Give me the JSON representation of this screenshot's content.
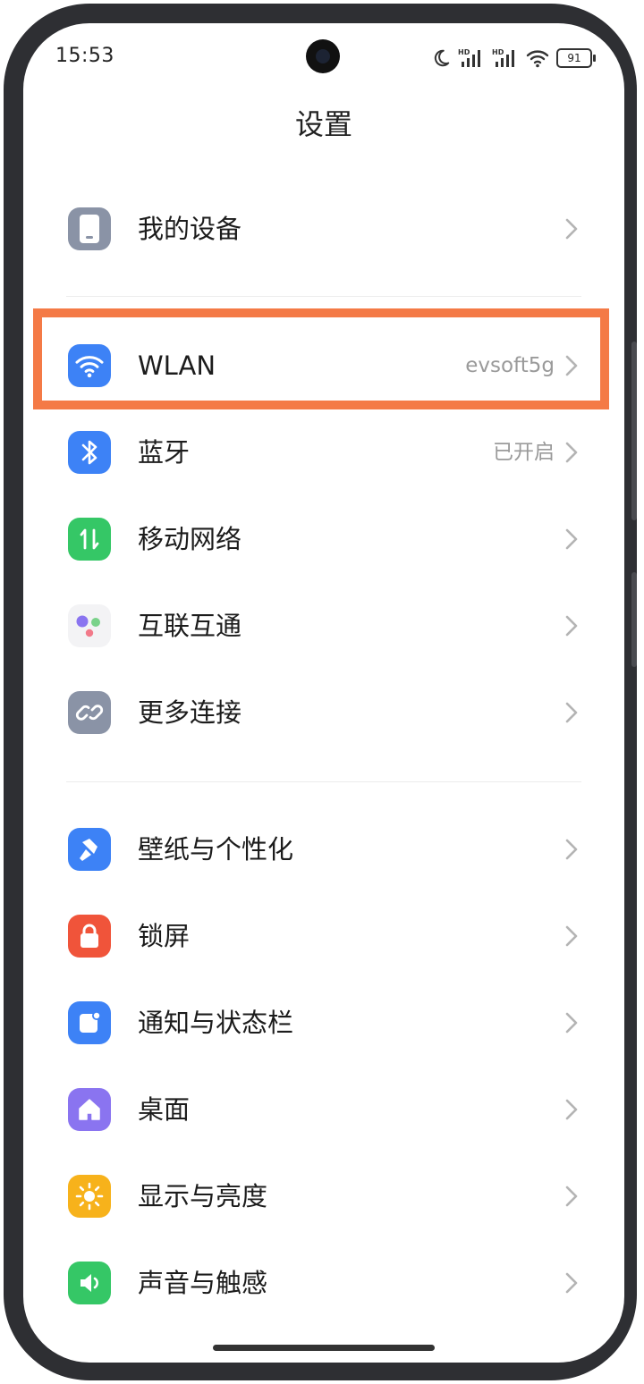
{
  "status_bar": {
    "time": "15:53",
    "battery": "91",
    "icons": [
      "moon-icon",
      "hd-signal-icon",
      "hd-signal-icon",
      "wifi-icon",
      "battery-icon"
    ],
    "hd_label": "HD"
  },
  "header": {
    "title": "设置"
  },
  "groups": [
    {
      "items": [
        {
          "label": "我的设备",
          "value": "",
          "icon": "phone-icon",
          "color": "#8a93a6"
        }
      ]
    },
    {
      "items": [
        {
          "label": "WLAN",
          "value": "evsoft5g",
          "icon": "wifi-icon",
          "color": "#3d82f6"
        },
        {
          "label": "蓝牙",
          "value": "已开启",
          "icon": "bluetooth-icon",
          "color": "#3d82f6"
        },
        {
          "label": "移动网络",
          "value": "",
          "icon": "mobile-data-icon",
          "color": "#35c766"
        },
        {
          "label": "互联互通",
          "value": "",
          "icon": "interconnect-icon",
          "color": "#f3f3f5"
        },
        {
          "label": "更多连接",
          "value": "",
          "icon": "link-icon",
          "color": "#8a93a6"
        }
      ]
    },
    {
      "items": [
        {
          "label": "壁纸与个性化",
          "value": "",
          "icon": "brush-icon",
          "color": "#3d82f6"
        },
        {
          "label": "锁屏",
          "value": "",
          "icon": "lock-icon",
          "color": "#f0543a"
        },
        {
          "label": "通知与状态栏",
          "value": "",
          "icon": "notification-icon",
          "color": "#3d82f6"
        },
        {
          "label": "桌面",
          "value": "",
          "icon": "home-icon",
          "color": "#8a74f0"
        },
        {
          "label": "显示与亮度",
          "value": "",
          "icon": "sun-icon",
          "color": "#f7b21b"
        },
        {
          "label": "声音与触感",
          "value": "",
          "icon": "speaker-icon",
          "color": "#35c766"
        }
      ]
    }
  ],
  "highlight": {
    "target": "WLAN",
    "color": "#f47a46"
  }
}
